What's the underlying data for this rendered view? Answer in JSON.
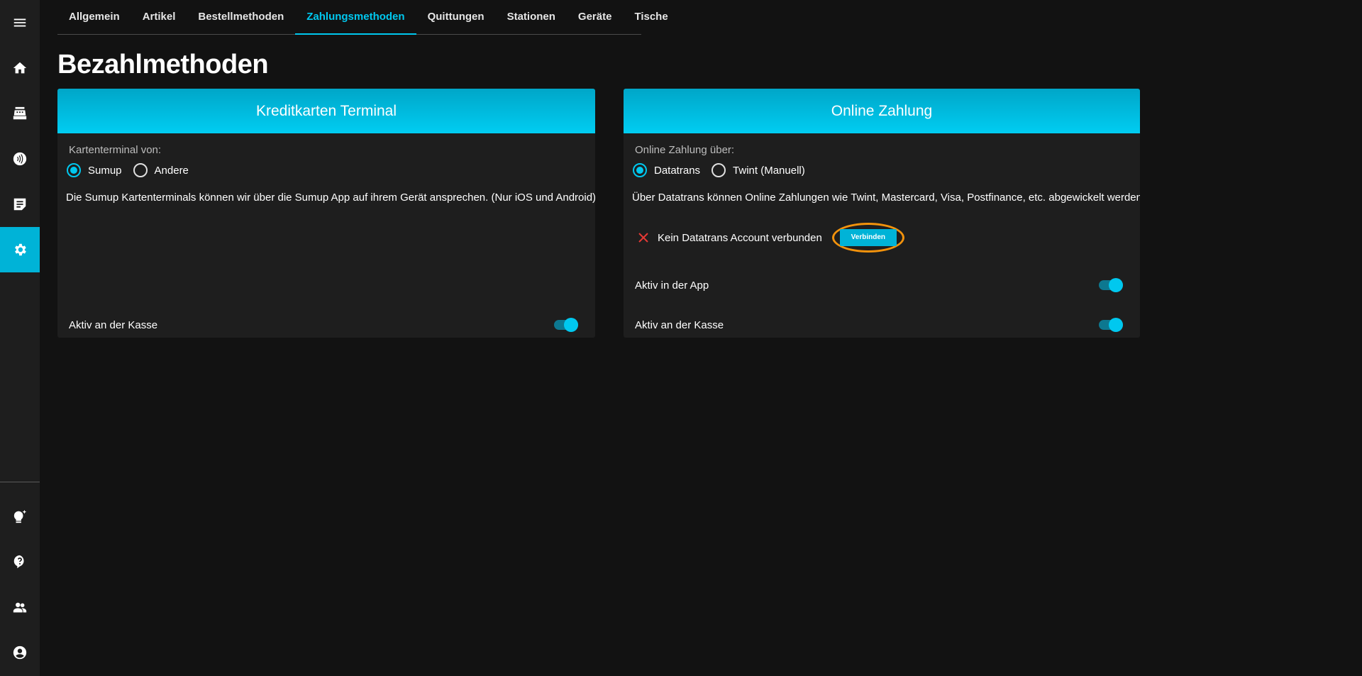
{
  "sidebar": {
    "top_items": [
      {
        "icon": "menu-icon"
      },
      {
        "icon": "home-icon"
      },
      {
        "icon": "cash-register-icon"
      },
      {
        "icon": "nfc-icon"
      },
      {
        "icon": "note-icon"
      },
      {
        "icon": "gear-icon",
        "active": true
      }
    ],
    "bottom_items": [
      {
        "icon": "lightbulb-sparkle-icon"
      },
      {
        "icon": "help-icon"
      },
      {
        "icon": "people-icon"
      },
      {
        "icon": "account-icon"
      }
    ]
  },
  "tabs": [
    {
      "label": "Allgemein"
    },
    {
      "label": "Artikel"
    },
    {
      "label": "Bestellmethoden"
    },
    {
      "label": "Zahlungsmethoden",
      "active": true
    },
    {
      "label": "Quittungen"
    },
    {
      "label": "Stationen"
    },
    {
      "label": "Geräte"
    },
    {
      "label": "Tische"
    }
  ],
  "page_title": "Bezahlmethoden",
  "card_terminal": {
    "title": "Kreditkarten Terminal",
    "field_label": "Kartenterminal von:",
    "options": [
      {
        "label": "Sumup",
        "checked": true
      },
      {
        "label": "Andere",
        "checked": false
      }
    ],
    "description": "Die Sumup Kartenterminals können wir über die Sumup App auf ihrem Gerät ansprechen. (Nur iOS und Android)",
    "toggle_kasse": {
      "label": "Aktiv an der Kasse",
      "on": true
    }
  },
  "card_online": {
    "title": "Online Zahlung",
    "field_label": "Online Zahlung über:",
    "options": [
      {
        "label": "Datatrans",
        "checked": true
      },
      {
        "label": "Twint (Manuell)",
        "checked": false
      }
    ],
    "description": "Über Datatrans können Online Zahlungen wie Twint, Mastercard, Visa, Postfinance, etc. abgewickelt werden.",
    "status_text": "Kein Datatrans Account verbunden",
    "connect_label": "Verbinden",
    "toggle_app": {
      "label": "Aktiv in der App",
      "on": true
    },
    "toggle_kasse": {
      "label": "Aktiv an der Kasse",
      "on": true
    }
  },
  "colors": {
    "accent": "#00c8ef",
    "highlight_ring": "#f2920c",
    "error": "#e53935"
  }
}
